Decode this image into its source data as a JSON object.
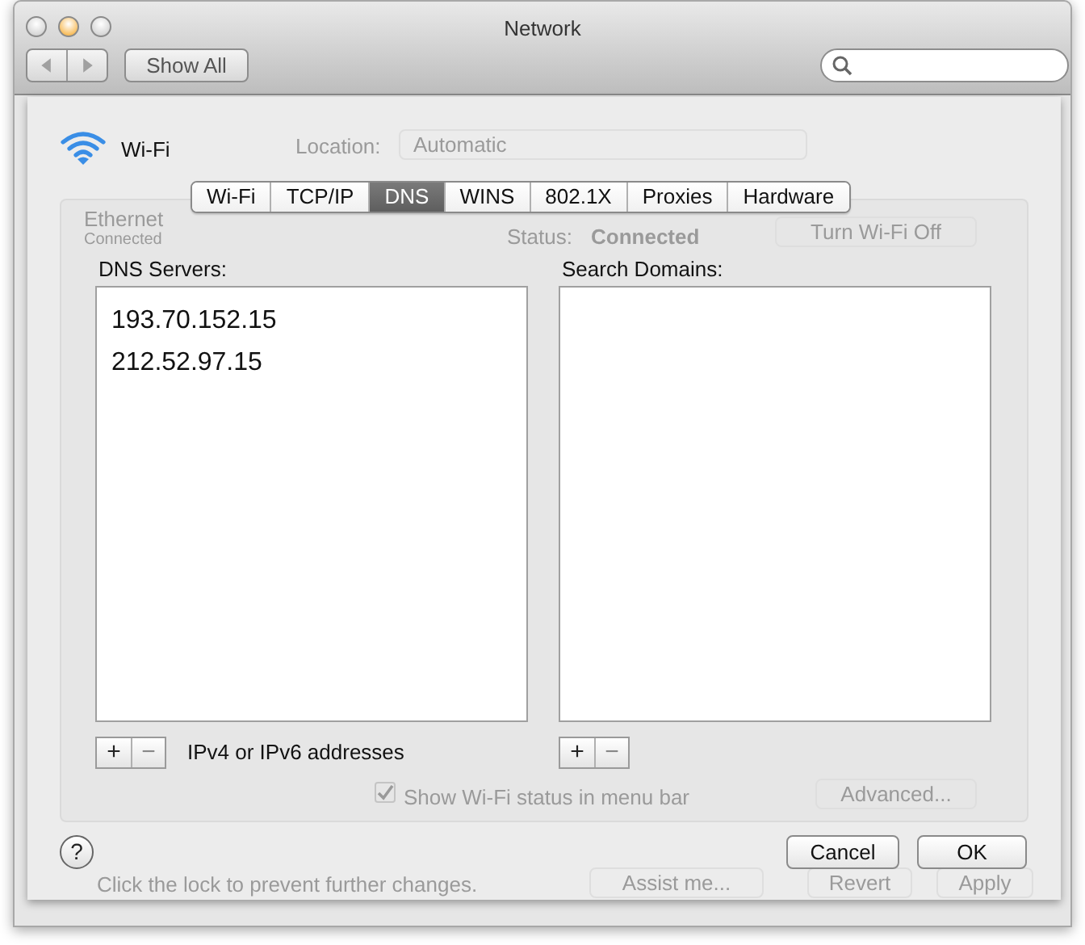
{
  "window": {
    "title": "Network"
  },
  "toolbar": {
    "show_all": "Show All"
  },
  "interface": {
    "name": "Wi-Fi"
  },
  "tabs": [
    {
      "label": "Wi-Fi",
      "selected": false
    },
    {
      "label": "TCP/IP",
      "selected": false
    },
    {
      "label": "DNS",
      "selected": true
    },
    {
      "label": "WINS",
      "selected": false
    },
    {
      "label": "802.1X",
      "selected": false
    },
    {
      "label": "Proxies",
      "selected": false
    },
    {
      "label": "Hardware",
      "selected": false
    }
  ],
  "dns_servers": {
    "label": "DNS Servers:",
    "entries": [
      "193.70.152.15",
      "212.52.97.15"
    ],
    "add": "+",
    "remove": "−",
    "hint": "IPv4 or IPv6 addresses"
  },
  "search_domains": {
    "label": "Search Domains:",
    "add": "+",
    "remove": "−"
  },
  "help": "?",
  "buttons": [
    "Cancel",
    "OK"
  ],
  "background": {
    "location_label": "Location:",
    "location_value": "Automatic",
    "service_name": "Ethernet",
    "service_status": "Connected",
    "status_label": "Status:",
    "status_value": "Connected",
    "turn_off": "Turn Wi-Fi Off",
    "show_status": {
      "label": "Show Wi-Fi status in menu bar",
      "checked": true
    },
    "advanced": "Advanced...",
    "lock_text": "Click the lock to prevent further changes.",
    "assist": "Assist me...",
    "revert": "Revert",
    "apply": "Apply"
  }
}
